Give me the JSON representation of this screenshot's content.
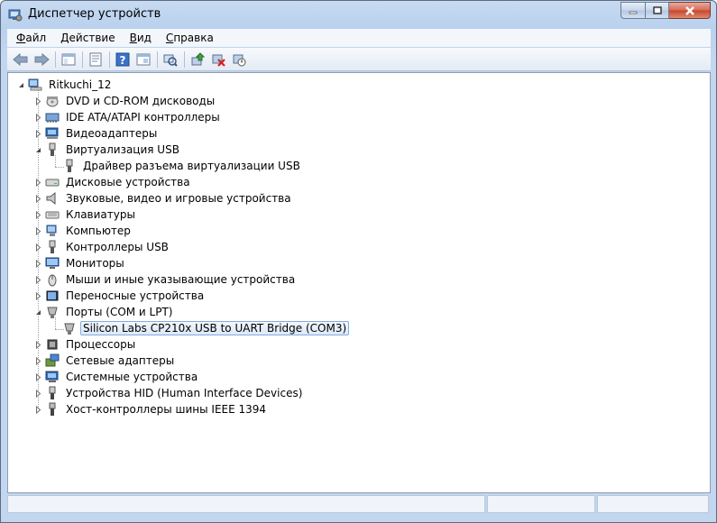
{
  "window": {
    "title": "Диспетчер устройств"
  },
  "menu": [
    "Файл",
    "Действие",
    "Вид",
    "Справка"
  ],
  "toolbar": {
    "buttons": [
      "back-icon",
      "forward-icon",
      "sep",
      "show-hide-tree-icon",
      "sep",
      "properties-icon",
      "sep",
      "help-icon",
      "view-icon",
      "sep",
      "scan-hardware-icon",
      "sep",
      "update-driver-icon",
      "uninstall-icon",
      "disable-icon"
    ]
  },
  "tree": {
    "root": "Ritkuchi_12",
    "items": [
      {
        "label": "DVD и CD-ROM дисководы",
        "icon": "dvd-icon",
        "expanded": false
      },
      {
        "label": "IDE ATA/ATAPI контроллеры",
        "icon": "ide-controller-icon",
        "expanded": false
      },
      {
        "label": "Видеоадаптеры",
        "icon": "display-adapter-icon",
        "expanded": false
      },
      {
        "label": "Виртуализация USB",
        "icon": "usb-plug-icon",
        "expanded": true
      },
      {
        "label": "Драйвер разъема виртуализации USB",
        "icon": "usb-plug-icon",
        "child": true
      },
      {
        "label": "Дисковые устройства",
        "icon": "disk-drive-icon",
        "expanded": false
      },
      {
        "label": "Звуковые, видео и игровые устройства",
        "icon": "speaker-icon",
        "expanded": false
      },
      {
        "label": "Клавиатуры",
        "icon": "keyboard-icon",
        "expanded": false
      },
      {
        "label": "Компьютер",
        "icon": "computer-icon",
        "expanded": false
      },
      {
        "label": "Контроллеры USB",
        "icon": "usb-plug-icon",
        "expanded": false
      },
      {
        "label": "Мониторы",
        "icon": "monitor-icon",
        "expanded": false
      },
      {
        "label": "Мыши и иные указывающие устройства",
        "icon": "mouse-icon",
        "expanded": false
      },
      {
        "label": "Переносные устройства",
        "icon": "portable-device-icon",
        "expanded": false
      },
      {
        "label": "Порты (COM и LPT)",
        "icon": "port-icon",
        "expanded": true
      },
      {
        "label": "Silicon Labs CP210x USB to UART Bridge (COM3)",
        "icon": "port-icon",
        "child": true,
        "selected": true
      },
      {
        "label": "Процессоры",
        "icon": "processor-icon",
        "expanded": false
      },
      {
        "label": "Сетевые адаптеры",
        "icon": "network-adapter-icon",
        "expanded": false
      },
      {
        "label": "Системные устройства",
        "icon": "system-device-icon",
        "expanded": false
      },
      {
        "label": "Устройства HID (Human Interface Devices)",
        "icon": "hid-icon",
        "expanded": false
      },
      {
        "label": "Хост-контроллеры шины IEEE 1394",
        "icon": "ieee1394-icon",
        "expanded": false
      }
    ]
  }
}
